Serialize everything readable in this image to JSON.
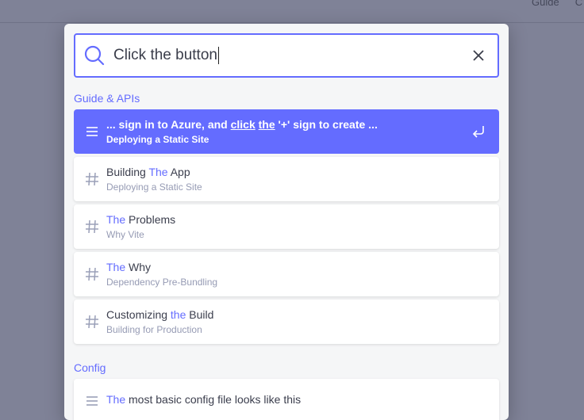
{
  "topnav": {
    "items": [
      "Guide",
      "C"
    ]
  },
  "search": {
    "query": "Click the button"
  },
  "sections": {
    "guide_title": "Guide & APIs",
    "config_title": "Config"
  },
  "hits": {
    "h0": {
      "t1": "... sign in to Azure, and ",
      "t2": "click",
      "t3": " ",
      "t4": "the",
      "t5": " '+' sign to create ...",
      "sub": "Deploying a Static Site"
    },
    "h1": {
      "t1": "Building ",
      "t2": "The",
      "t3": " App",
      "sub": "Deploying a Static Site"
    },
    "h2": {
      "t1": "The",
      "t2": " Problems",
      "sub": "Why Vite"
    },
    "h3": {
      "t1": "The",
      "t2": " Why",
      "sub": "Dependency Pre-Bundling"
    },
    "h4": {
      "t1": "Customizing ",
      "t2": "the",
      "t3": " Build",
      "sub": "Building for Production"
    },
    "h5": {
      "t1": "The",
      "t2": " most basic config file looks like this",
      "sub": ""
    }
  },
  "icons": {
    "search": "search-icon",
    "clear": "close-icon",
    "menu": "menu-lines-icon",
    "hash": "hash-icon",
    "enter": "enter-return-icon"
  },
  "colors": {
    "accent": "#646cff",
    "backdrop": "#7f8297",
    "panel": "#f5f6f7"
  }
}
